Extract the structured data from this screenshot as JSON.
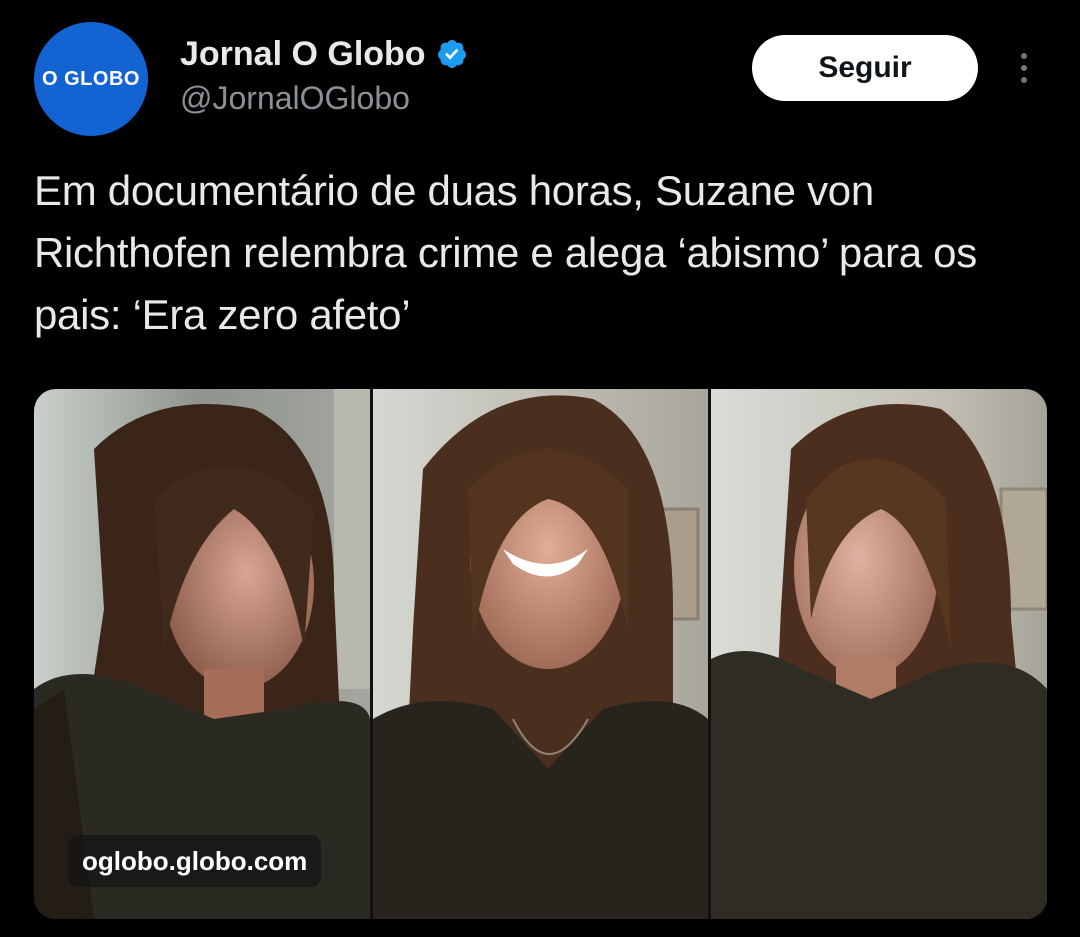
{
  "author": {
    "avatar_text": "O GLOBO",
    "display_name": "Jornal O Globo",
    "handle": "@JornalOGlobo",
    "verified_icon": "verified-badge-icon",
    "avatar_color": "#1463d2",
    "verified_color": "#1d9bf0"
  },
  "actions": {
    "follow_label": "Seguir",
    "more_icon": "more-vertical-icon"
  },
  "tweet": {
    "text": "Em documentário de duas horas, Suzane von Richthofen relembra crime e alega ‘abismo’ para os pais: ‘Era zero afeto’"
  },
  "media": {
    "link_domain": "oglobo.globo.com",
    "panel_count": 3
  },
  "colors": {
    "background": "#000000",
    "text_primary": "#e7e9ea",
    "text_secondary": "#8b9096",
    "button_bg": "#ffffff",
    "button_text": "#0f1419"
  }
}
